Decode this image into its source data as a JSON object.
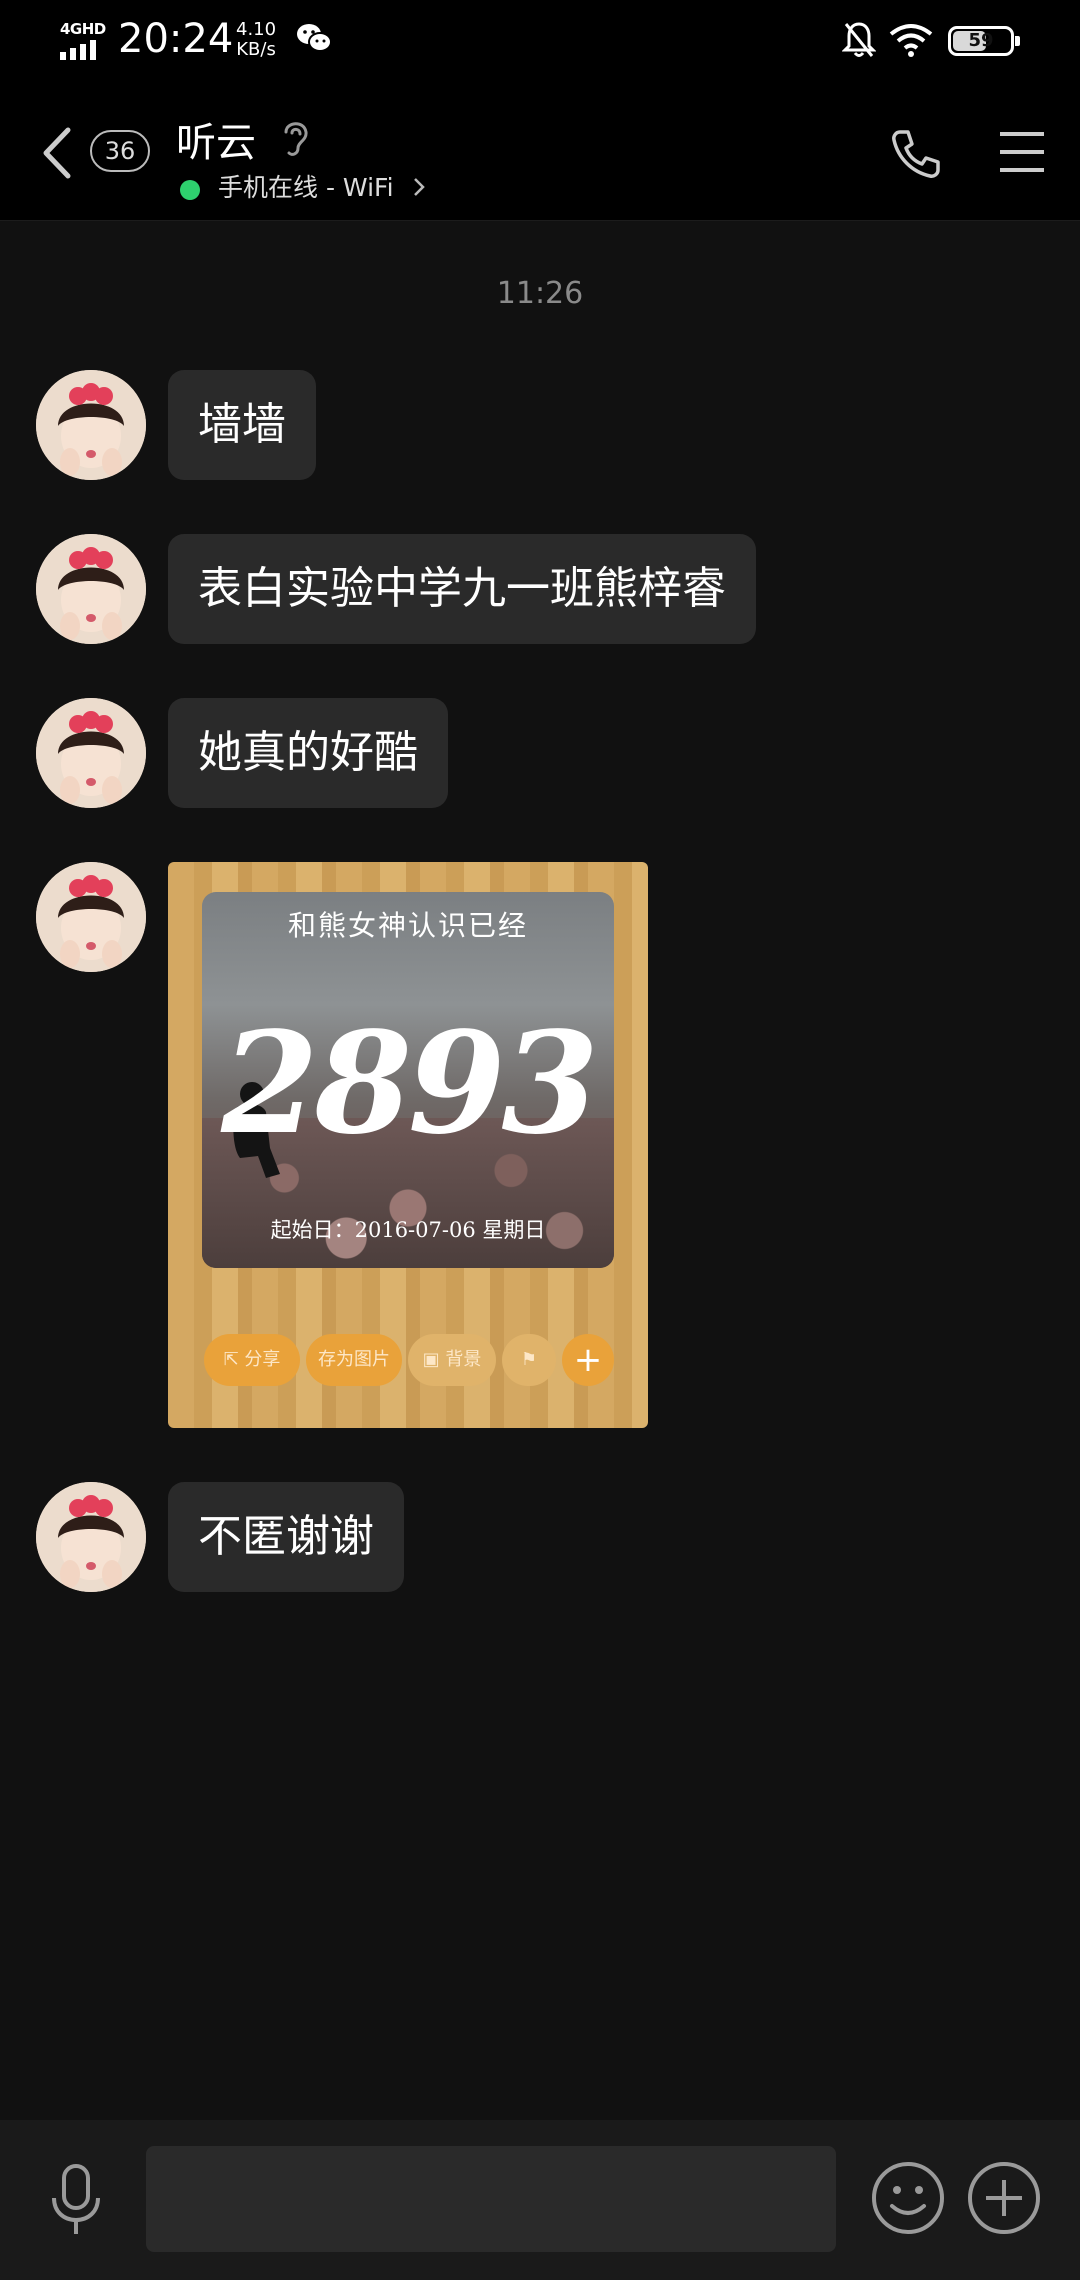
{
  "status_bar": {
    "network": "4GHD",
    "time": "20:24",
    "speed_value": "4.10",
    "speed_unit": "KB/s",
    "battery": "59",
    "battery_level": 0.59,
    "icons": [
      "chat-app-icon",
      "mute-icon",
      "wifi-icon",
      "battery-icon"
    ]
  },
  "header": {
    "unread_count": "36",
    "contact_name": "听云",
    "online_status": "手机在线 - WiFi",
    "online_color": "#2ed06e"
  },
  "chat": {
    "timestamp": "11:26",
    "messages": [
      {
        "type": "text",
        "text": "墙墙"
      },
      {
        "type": "text",
        "text": "表白实验中学九一班熊梓睿"
      },
      {
        "type": "text",
        "text": "她真的好酷"
      },
      {
        "type": "image",
        "card": {
          "caption": "和熊女神认识已经",
          "count": "2893",
          "start_date": "起始日：2016-07-06 星期日",
          "actions": [
            "分享",
            "存为图片",
            "背景"
          ]
        }
      },
      {
        "type": "text",
        "text": "不匿谢谢"
      }
    ]
  },
  "input_bar": {
    "placeholder": "",
    "icons": [
      "microphone-icon",
      "emoji-icon",
      "plus-icon"
    ]
  },
  "colors": {
    "background": "#111111",
    "bubble": "#2a2a2a",
    "accent_orange": "#e9a23a"
  }
}
